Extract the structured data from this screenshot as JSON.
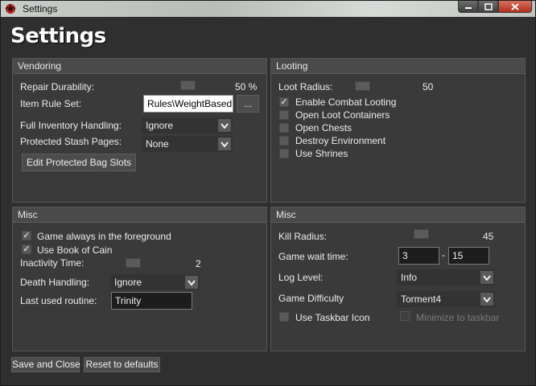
{
  "window": {
    "title": "Settings"
  },
  "page_title": "Settings",
  "vendoring": {
    "header": "Vendoring",
    "repair_durability_label": "Repair Durability:",
    "repair_durability_value": "50 %",
    "item_rule_set_label": "Item Rule Set:",
    "item_rule_set_value": "Rules\\WeightBasedPi",
    "browse_label": "...",
    "full_inventory_label": "Full Inventory Handling:",
    "full_inventory_value": "Ignore",
    "protected_stash_label": "Protected Stash Pages:",
    "protected_stash_value": "None",
    "edit_bag_slots_label": "Edit Protected Bag Slots"
  },
  "looting": {
    "header": "Looting",
    "loot_radius_label": "Loot Radius:",
    "loot_radius_value": "50",
    "checkboxes": [
      {
        "label": "Enable Combat Looting",
        "checked": true
      },
      {
        "label": "Open Loot Containers",
        "checked": false
      },
      {
        "label": "Open Chests",
        "checked": false
      },
      {
        "label": "Destroy Environment",
        "checked": false
      },
      {
        "label": "Use Shrines",
        "checked": false
      }
    ]
  },
  "misc_left": {
    "header": "Misc",
    "foreground_label": "Game always in the foreground",
    "book_of_cain_label": "Use Book of Cain",
    "inactivity_label": "Inactivity Time:",
    "inactivity_value": "2",
    "death_handling_label": "Death Handling:",
    "death_handling_value": "Ignore",
    "last_routine_label": "Last used routine:",
    "last_routine_value": "Trinity"
  },
  "misc_right": {
    "header": "Misc",
    "kill_radius_label": "Kill Radius:",
    "kill_radius_value": "45",
    "wait_time_label": "Game wait time:",
    "wait_time_min": "3",
    "wait_time_sep": "-",
    "wait_time_max": "15",
    "log_level_label": "Log Level:",
    "log_level_value": "Info",
    "difficulty_label": "Game Difficulty",
    "difficulty_value": "Torment4",
    "taskbar_icon_label": "Use Taskbar Icon",
    "minimize_label": "Minimize to taskbar"
  },
  "footer": {
    "save_label": "Save and Close",
    "reset_label": "Reset to defaults"
  }
}
